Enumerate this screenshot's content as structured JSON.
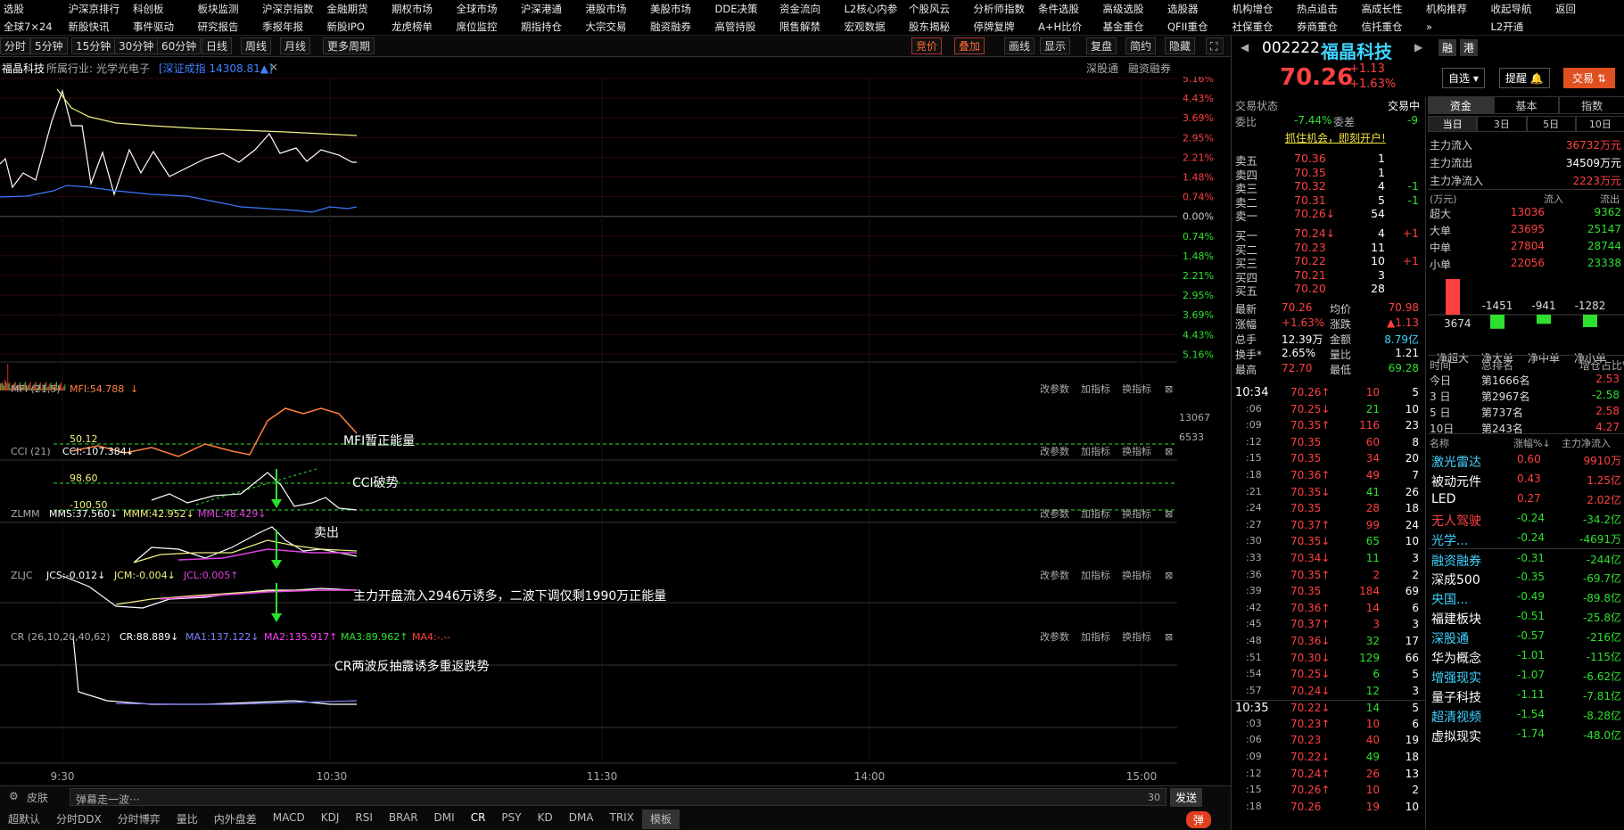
{
  "menu_row1": [
    "选股",
    "沪深京排行",
    "科创板",
    "板块监测",
    "沪深京指数",
    "金融期货",
    "期权市场",
    "全球市场",
    "沪深港通",
    "港股市场",
    "美股市场",
    "DDE决策",
    "资金流向",
    "L2核心内参",
    "个股风云",
    "分析师指数",
    "条件选股",
    "高级选股",
    "选股器",
    "机构增仓",
    "热点追击",
    "高成长性",
    "机构推荐",
    "收起导航",
    "返回"
  ],
  "menu_row2": [
    "全球7×24",
    "新股快讯",
    "事件驱动",
    "研究报告",
    "季报年报",
    "新股IPO",
    "龙虎榜单",
    "席位监控",
    "期指持仓",
    "大宗交易",
    "融资融券",
    "高管持股",
    "限售解禁",
    "宏观数据",
    "股东揭秘",
    "停牌复牌",
    "A+H比价",
    "基金重仓",
    "QFII重仓",
    "社保重仓",
    "券商重仓",
    "信托重仓",
    "»",
    "L2开通"
  ],
  "toolbar": {
    "periods": [
      "分时",
      "5分钟",
      "15分钟",
      "30分钟",
      "60分钟",
      "日线",
      "周线",
      "月线",
      "更多周期"
    ],
    "right": [
      "竞价",
      "叠加",
      "画线",
      "显示",
      "复盘",
      "简约",
      "隐藏"
    ]
  },
  "info": {
    "stock": "福晶科技",
    "industry_label": "所属行业:",
    "industry": "光学光电子",
    "index": "[深证成指 14308.81▲]",
    "close": "×",
    "link1": "深股通",
    "link2": "融资融券"
  },
  "axis": {
    "pct_top": [
      "5.16%",
      "4.43%",
      "3.69%",
      "2.95%",
      "2.21%",
      "1.48%",
      "0.74%",
      "0.00%"
    ],
    "pct_bottom": [
      "0.74%",
      "1.48%",
      "2.21%",
      "2.95%",
      "3.69%",
      "4.43%",
      "5.16%"
    ],
    "vol": [
      "13067",
      "6533"
    ],
    "time": [
      "9:30",
      "10:30",
      "11:30",
      "14:00",
      "15:00"
    ]
  },
  "indicators": {
    "mfi": {
      "name": "MFI (21,5)",
      "val": "MFI:54.788",
      "arrow": "↓",
      "lvl": "50.12",
      "note": "MFI暂正能量"
    },
    "cci": {
      "name": "CCI (21)",
      "val": "CCI:-107.384",
      "arrow": "↓",
      "lvl1": "98.60",
      "lvl2": "-100.50",
      "note": "CCI破势"
    },
    "zlmm": {
      "name": "ZLMM",
      "mms": "MMS:37.560↓",
      "mmm": "MMM:42.952↓",
      "mml": "MML:48.429↓",
      "note": "卖出"
    },
    "zljc": {
      "name": "ZLJC",
      "jcs": "JCS:-0.012↓",
      "jcm": "JCM:-0.004↓",
      "jcl": "JCL:0.005↑",
      "note": "主力开盘流入2946万诱多，二波下调仅剩1990万正能量"
    },
    "cr": {
      "name": "CR (26,10,20,40,62)",
      "cr": "CR:88.889↓",
      "ma1": "MA1:137.122↓",
      "ma2": "MA2:135.917↑",
      "ma3": "MA3:89.962↑",
      "ma4": "MA4:-.--",
      "note": "CR两波反抽露诱多重返跌势"
    },
    "btns": [
      "改参数",
      "加指标",
      "换指标"
    ]
  },
  "bottom": {
    "skin": "皮肤",
    "danmu": "弹幕走一波···",
    "count": "30",
    "send": "发送",
    "tabs": [
      "超默认",
      "分时DDX",
      "分时博弈",
      "量比",
      "内外盘差",
      "MACD",
      "KDJ",
      "RSI",
      "BRAR",
      "DMI",
      "CR",
      "PSY",
      "KD",
      "DMA",
      "TRIX",
      "模板"
    ],
    "toggle": "弹"
  },
  "quote": {
    "code": "002222",
    "name": "福晶科技",
    "price": "70.26",
    "chg": "+1.13",
    "pct": "+1.63%",
    "btn1": "融",
    "btn2": "港",
    "zixuan": "自选",
    "tixing": "提醒",
    "jiaoyi": "交易"
  },
  "status": {
    "label": "交易状态",
    "value": "交易中",
    "weibi_l": "委比",
    "weibi": "-7.44%",
    "weicha_l": "委差",
    "weicha": "-9",
    "ad": "抓住机会，即刻开户!"
  },
  "asks": [
    [
      "卖五",
      "70.36",
      "1",
      ""
    ],
    [
      "卖四",
      "70.35",
      "1",
      ""
    ],
    [
      "卖三",
      "70.32",
      "4",
      "-1"
    ],
    [
      "卖二",
      "70.31",
      "5",
      "-1"
    ],
    [
      "卖一",
      "70.26↓",
      "54",
      ""
    ]
  ],
  "bids": [
    [
      "买一",
      "70.24↓",
      "4",
      "+1"
    ],
    [
      "买二",
      "70.23",
      "11",
      ""
    ],
    [
      "买三",
      "70.22",
      "10",
      "+1"
    ],
    [
      "买四",
      "70.21",
      "3",
      ""
    ],
    [
      "买五",
      "70.20",
      "28",
      ""
    ]
  ],
  "stats": [
    [
      "最新",
      "70.26",
      "均价",
      "70.98"
    ],
    [
      "涨幅",
      "+1.63%",
      "涨跌",
      "▲1.13"
    ],
    [
      "总手",
      "12.39万",
      "金额",
      "8.79亿"
    ],
    [
      "换手*",
      "2.65%",
      "量比",
      "1.21"
    ],
    [
      "最高",
      "72.70",
      "最低",
      "69.28"
    ]
  ],
  "ticks": [
    [
      "10:34",
      "70.26↑",
      "10",
      "5"
    ],
    [
      ":06",
      "70.25↓",
      "21",
      "10"
    ],
    [
      ":09",
      "70.35↑",
      "116",
      "23"
    ],
    [
      ":12",
      "70.35",
      "60",
      "8"
    ],
    [
      ":15",
      "70.35",
      "34",
      "20"
    ],
    [
      ":18",
      "70.36↑",
      "49",
      "7"
    ],
    [
      ":21",
      "70.35↓",
      "41",
      "26"
    ],
    [
      ":24",
      "70.35",
      "28",
      "18"
    ],
    [
      ":27",
      "70.37↑",
      "99",
      "24"
    ],
    [
      ":30",
      "70.35↓",
      "65",
      "10"
    ],
    [
      ":33",
      "70.34↓",
      "11",
      "3"
    ],
    [
      ":36",
      "70.35↑",
      "2",
      "2"
    ],
    [
      ":39",
      "70.35",
      "184",
      "69"
    ],
    [
      ":42",
      "70.36↑",
      "14",
      "6"
    ],
    [
      ":45",
      "70.37↑",
      "3",
      "3"
    ],
    [
      ":48",
      "70.36↓",
      "32",
      "17"
    ],
    [
      ":51",
      "70.30↓",
      "129",
      "66"
    ],
    [
      ":54",
      "70.25↓",
      "6",
      "5"
    ],
    [
      ":57",
      "70.24↓",
      "12",
      "3"
    ],
    [
      "10:35",
      "70.22↓",
      "14",
      "5"
    ],
    [
      ":03",
      "70.23↑",
      "10",
      "6"
    ],
    [
      ":06",
      "70.23",
      "40",
      "19"
    ],
    [
      ":09",
      "70.22↓",
      "49",
      "18"
    ],
    [
      ":12",
      "70.24↑",
      "26",
      "13"
    ],
    [
      ":15",
      "70.26↑",
      "10",
      "2"
    ],
    [
      ":18",
      "70.26",
      "19",
      "10"
    ]
  ],
  "fund": {
    "tabs": [
      "资金",
      "基本",
      "指数"
    ],
    "periods": [
      "当日",
      "3日",
      "5日",
      "10日"
    ],
    "rows": [
      [
        "主力流入",
        "36732万元"
      ],
      [
        "主力流出",
        "34509万元"
      ],
      [
        "主力净流入",
        "2223万元"
      ]
    ],
    "unit": "(万元)",
    "in": "流入",
    "out": "流出",
    "flows": [
      [
        "超大",
        "13036",
        "9362"
      ],
      [
        "大单",
        "23695",
        "25147"
      ],
      [
        "中单",
        "27804",
        "28744"
      ],
      [
        "小单",
        "22056",
        "23338"
      ]
    ],
    "bars": [
      3674,
      -1451,
      -941,
      -1282
    ],
    "bar_labels": [
      "净超大",
      "净大单",
      "净中单",
      "净小单"
    ]
  },
  "rank": {
    "hdr": [
      "时间",
      "总排名",
      "增仓占比%"
    ],
    "rows": [
      [
        "今日",
        "第1666名",
        "2.53"
      ],
      [
        "3 日",
        "第2967名",
        "-2.58"
      ],
      [
        "5 日",
        "第737名",
        "2.58"
      ],
      [
        "10日",
        "第243名",
        "4.27"
      ]
    ]
  },
  "sectors": {
    "hdr": [
      "名称",
      "涨幅%↓",
      "主力净流入"
    ],
    "rows": [
      [
        "激光雷达",
        "0.60",
        "9910万"
      ],
      [
        "被动元件",
        "0.43",
        "1.25亿"
      ],
      [
        "LED",
        "0.27",
        "2.02亿"
      ],
      [
        "无人驾驶",
        "-0.24",
        "-34.2亿"
      ],
      [
        "光学...",
        "-0.24",
        "-4691万"
      ],
      [
        "融资融券",
        "-0.31",
        "-244亿"
      ],
      [
        "深成500",
        "-0.35",
        "-69.7亿"
      ],
      [
        "央国...",
        "-0.49",
        "-89.8亿"
      ],
      [
        "福建板块",
        "-0.51",
        "-25.8亿"
      ],
      [
        "深股通",
        "-0.57",
        "-216亿"
      ],
      [
        "华为概念",
        "-1.01",
        "-115亿"
      ],
      [
        "增强现实",
        "-1.07",
        "-6.62亿"
      ],
      [
        "量子科技",
        "-1.11",
        "-7.81亿"
      ],
      [
        "超清视频",
        "-1.54",
        "-8.28亿"
      ],
      [
        "虚拟现实",
        "-1.74",
        "-48.0亿"
      ]
    ]
  },
  "colors": {
    "up": "#ff4040",
    "down": "#2ee02e",
    "price_line": "#ffffff",
    "avg_line": "#f0f080",
    "index_line": "#3a7aff"
  }
}
